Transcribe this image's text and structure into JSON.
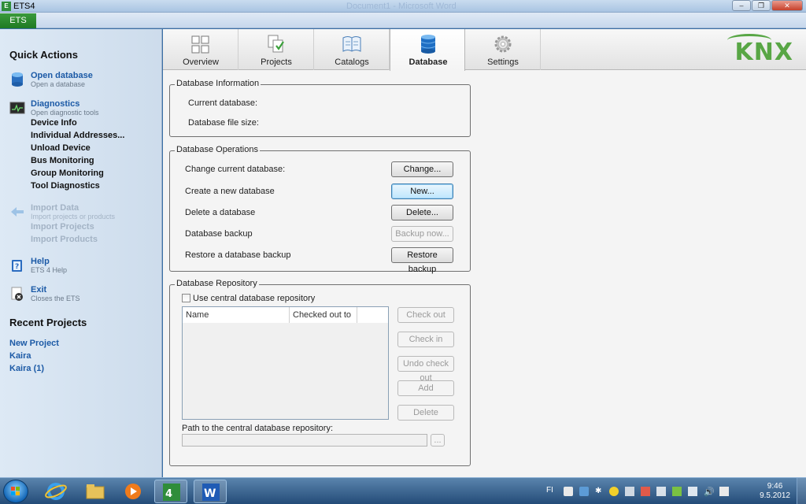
{
  "window": {
    "title": "ETS4",
    "ghost_title": "Document1 - Microsoft Word",
    "minimize": "‒",
    "maximize": "❐",
    "close": "✕"
  },
  "ribbon": {
    "ets_tab": "ETS"
  },
  "sidebar": {
    "quick_actions_heading": "Quick Actions",
    "open_database": {
      "title": "Open database",
      "sub": "Open a database"
    },
    "diagnostics": {
      "title": "Diagnostics",
      "sub": "Open diagnostic tools"
    },
    "diag_items": [
      "Device Info",
      "Individual Addresses...",
      "Unload Device",
      "Bus Monitoring",
      "Group Monitoring",
      "Tool Diagnostics"
    ],
    "import_data": {
      "title": "Import Data",
      "sub": "Import projects or products"
    },
    "import_items": [
      "Import Projects",
      "Import Products"
    ],
    "help": {
      "title": "Help",
      "sub": "ETS 4 Help"
    },
    "exit": {
      "title": "Exit",
      "sub": "Closes the ETS"
    },
    "recent_heading": "Recent Projects",
    "recent_items": [
      "New Project",
      "Kaira",
      "Kaira (1)"
    ]
  },
  "tabs": [
    {
      "label": "Overview",
      "icon": "overview-icon"
    },
    {
      "label": "Projects",
      "icon": "projects-icon"
    },
    {
      "label": "Catalogs",
      "icon": "catalogs-icon"
    },
    {
      "label": "Database",
      "icon": "database-icon",
      "active": true
    },
    {
      "label": "Settings",
      "icon": "settings-icon"
    }
  ],
  "logo": "KNX",
  "db_info": {
    "legend": "Database Information",
    "current_label": "Current database:",
    "size_label": "Database file size:"
  },
  "db_ops": {
    "legend": "Database Operations",
    "rows": [
      {
        "label": "Change current database:",
        "button": "Change...",
        "enabled": true
      },
      {
        "label": "Create a new database",
        "button": "New...",
        "enabled": true,
        "focused": true
      },
      {
        "label": "Delete a database",
        "button": "Delete...",
        "enabled": true
      },
      {
        "label": "Database backup",
        "button": "Backup now...",
        "enabled": false
      },
      {
        "label": "Restore a database backup",
        "button": "Restore backup",
        "enabled": true
      }
    ]
  },
  "db_repo": {
    "legend": "Database Repository",
    "use_central_label": "Use central database repository",
    "use_central_checked": false,
    "columns": [
      "Name",
      "Checked out to"
    ],
    "buttons": [
      "Check out",
      "Check in",
      "Undo check out",
      "Add",
      "Delete"
    ],
    "path_label": "Path to the central database repository:",
    "path_value": "",
    "browse": "..."
  },
  "taskbar": {
    "lang": "FI",
    "time": "9:46",
    "date": "9.5.2012"
  },
  "colors": {
    "accent": "#1c5aa6",
    "ets_green": "#2f8d3a",
    "knx_green": "#58a645"
  }
}
